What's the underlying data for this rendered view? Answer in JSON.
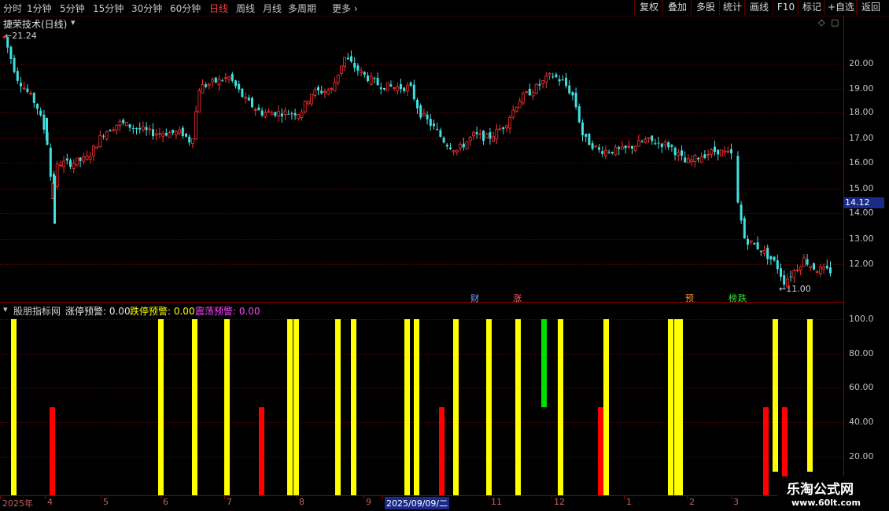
{
  "toolbar": {
    "periods": [
      "分时",
      "1分钟",
      "5分钟",
      "15分钟",
      "30分钟",
      "60分钟",
      "日线",
      "周线",
      "月线",
      "多周期"
    ],
    "active_period": "日线",
    "more_label": "更多",
    "right_buttons": [
      "复权",
      "叠加",
      "多股",
      "统计",
      "画线",
      "F10",
      "标记",
      "+自选",
      "返回"
    ]
  },
  "main_chart": {
    "title": "捷荣技术(日线)",
    "high_label": "21.24",
    "low_label": "11.00",
    "current_price": "14.12",
    "y_ticks": [
      "20.00",
      "19.00",
      "18.00",
      "17.00",
      "16.00",
      "15.00",
      "14.00",
      "13.00",
      "12.00"
    ],
    "markers": [
      {
        "text": "财",
        "color": "#80a0ff"
      },
      {
        "text": "涨",
        "color": "#ff6060"
      },
      {
        "text": "预",
        "color": "#ff9020"
      },
      {
        "text": "榜",
        "color": "#40e040"
      },
      {
        "text": "跌",
        "color": "#40e040"
      }
    ],
    "up_color": "#ff3030",
    "down_color": "#40e0e0"
  },
  "indicator": {
    "name": "股朋指标网",
    "limit_up_label": "涨停预警: 0.00",
    "limit_down_label": "跌停预警: 0.00",
    "oscillation_label": "震荡预警: 0.00",
    "limit_up_color": "#e8e8e8",
    "limit_down_color": "#ffff00",
    "oscillation_color": "#ff40ff",
    "y_ticks": [
      "100.0",
      "80.00",
      "60.00",
      "40.00",
      "20.00"
    ],
    "bars": [
      {
        "color": "yellow",
        "value": 100
      },
      {
        "color": "red",
        "value": 50
      },
      {
        "color": "yellow",
        "value": 100
      },
      {
        "color": "yellow",
        "value": 100
      },
      {
        "color": "yellow",
        "value": 100
      },
      {
        "color": "red",
        "value": 50
      },
      {
        "color": "yellow",
        "value": 100
      },
      {
        "color": "yellow",
        "value": 100
      },
      {
        "color": "yellow",
        "value": 100
      },
      {
        "color": "yellow",
        "value": 100
      },
      {
        "color": "yellow",
        "value": 100
      },
      {
        "color": "yellow",
        "value": 100
      },
      {
        "color": "red",
        "value": 50
      },
      {
        "color": "yellow",
        "value": 100
      },
      {
        "color": "yellow",
        "value": 100
      },
      {
        "color": "yellow",
        "value": 100
      },
      {
        "color": "green",
        "value": 100
      },
      {
        "color": "yellow",
        "value": 100
      },
      {
        "color": "red",
        "value": 50
      },
      {
        "color": "yellow",
        "value": 100
      },
      {
        "color": "yellow",
        "value": 100
      },
      {
        "color": "yellow",
        "value": 100
      },
      {
        "color": "yellow",
        "value": 100
      },
      {
        "color": "red",
        "value": 50
      },
      {
        "color": "yellow",
        "value": 100
      },
      {
        "color": "red",
        "value": 50
      },
      {
        "color": "yellow",
        "value": 100
      }
    ]
  },
  "x_axis": {
    "labels": [
      "2025年",
      "4",
      "5",
      "6",
      "7",
      "8",
      "9",
      "2025/09/09/二",
      "11",
      "12",
      "1",
      "2",
      "3"
    ]
  },
  "watermark": {
    "title": "乐淘公式网",
    "url": "www.60lt.com"
  }
}
